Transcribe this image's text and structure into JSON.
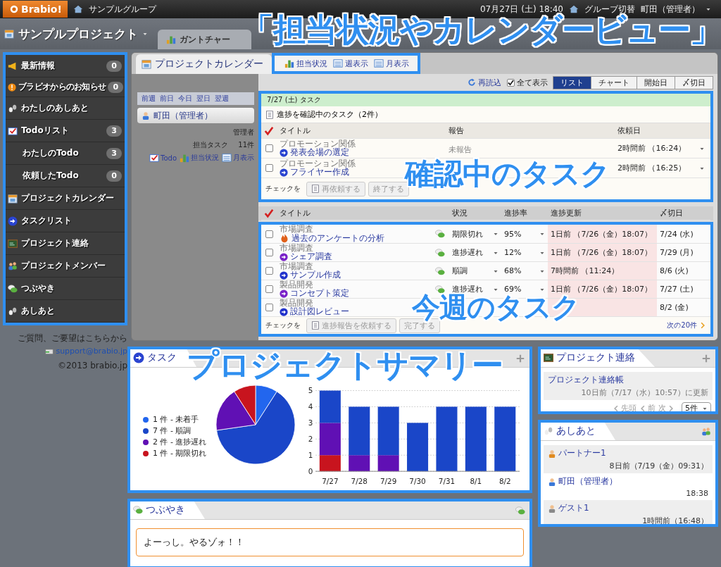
{
  "top_bar": {
    "logo": "Brabio!",
    "group": "サンプルグループ",
    "datetime": "07月27日 (土) 18:40",
    "switch": "グループ切替",
    "user": "町田（管理者）"
  },
  "project_bar": {
    "title": "サンプルプロジェクト",
    "tabs": [
      {
        "label": "ガントチャー",
        "selected": false
      }
    ]
  },
  "sidebar": {
    "items": [
      {
        "label": "最新情報",
        "count": "0",
        "kind": "main"
      },
      {
        "label": "ブラビオからのお知らせ",
        "count": "0",
        "kind": "notice"
      },
      {
        "label": "わたしのあしあと",
        "kind": "main"
      },
      {
        "label": "Todoリスト",
        "count": "3",
        "kind": "main"
      },
      {
        "label": "わたしのTodo",
        "count": "3",
        "kind": "sub"
      },
      {
        "label": "依頼したTodo",
        "count": "0",
        "kind": "sub"
      },
      {
        "label": "プロジェクトカレンダー",
        "kind": "main"
      },
      {
        "label": "タスクリスト",
        "kind": "main"
      },
      {
        "label": "プロジェクト連絡",
        "kind": "main"
      },
      {
        "label": "プロジェクトメンバー",
        "kind": "main"
      },
      {
        "label": "つぶやき",
        "kind": "main"
      },
      {
        "label": "あしあと",
        "kind": "main"
      }
    ],
    "footer": {
      "question": "ご質問、ご要望はこちらから",
      "email": "support@brabio.jp",
      "copyright": "©2013 brabio.jp"
    }
  },
  "calendar": {
    "title": "プロジェクトカレンダー",
    "views": [
      "担当状況",
      "週表示",
      "月表示"
    ],
    "nav": [
      "前週",
      "前日",
      "今日",
      "翌日",
      "翌週"
    ],
    "user": "町田（管理者）",
    "role": "管理者",
    "task_label": "担当タスク",
    "task_count": "11件",
    "links": [
      "Todo",
      "担当状況",
      "月表示"
    ],
    "toolbar": {
      "reload": "再読込",
      "show_all": {
        "label": "全て表示",
        "checked": true
      },
      "modes": [
        {
          "label": "リスト",
          "selected": true
        },
        {
          "label": "チャート",
          "selected": false
        },
        {
          "label": "開始日",
          "selected": false
        },
        {
          "label": "〆切日",
          "selected": false
        }
      ]
    },
    "confirm": {
      "date_header": "7/27 (土) タスク",
      "title": "進捗を確認中のタスク（2件）",
      "columns": [
        "タイトル",
        "報告",
        "依頼日"
      ],
      "rows": [
        {
          "category": "プロモーション関係",
          "title": "発表会場の選定",
          "report": "未報告",
          "requested": "2時間前 （16:24）",
          "checked": false
        },
        {
          "category": "プロモーション関係",
          "title": "フライヤー作成",
          "requested": "2時間前 （16:25）",
          "checked": false
        }
      ],
      "action_label": "チェックを",
      "buttons": [
        "再依頼する",
        "終了する"
      ]
    },
    "week": {
      "columns": [
        "タイトル",
        "状況",
        "進捗率",
        "進捗更新",
        "〆切日"
      ],
      "rows": [
        {
          "category": "市場調査",
          "title": "過去のアンケートの分析",
          "kind": "overdue",
          "color": "#e0601a",
          "status": "期限切れ",
          "progress": "95%",
          "updated": "1日前 （7/26（金）18:07）",
          "due": "7/24 (水)",
          "checked": false
        },
        {
          "category": "市場調査",
          "title": "シェア調査",
          "kind": "task",
          "color": "#7a22c8",
          "status": "進捗遅れ",
          "progress": "12%",
          "updated": "1日前 （7/26（金）18:07）",
          "due": "7/29 (月)",
          "checked": false
        },
        {
          "category": "市場調査",
          "title": "サンプル作成",
          "kind": "task",
          "color": "#2233cc",
          "status": "順調",
          "progress": "68%",
          "updated": "7時間前 （11:24）",
          "due": "8/6 (火)",
          "checked": false
        },
        {
          "category": "製品開発",
          "title": "コンセプト策定",
          "kind": "task",
          "color": "#7a22c8",
          "status": "進捗遅れ",
          "progress": "69%",
          "updated": "1日前 （7/26（金）18:07）",
          "due": "7/27 (土)",
          "checked": false
        },
        {
          "category": "製品開発",
          "title": "設計図レビュー",
          "kind": "task",
          "color": "#2233cc",
          "due": "8/2 (金)",
          "checked": false
        }
      ],
      "action_label": "チェックを",
      "buttons": [
        "進捗報告を依頼する",
        "完了する"
      ],
      "next": "次の20件"
    }
  },
  "summary": {
    "title": "タスク",
    "legend": [
      {
        "label": "1 件 - 未着手",
        "color": "#2266ee"
      },
      {
        "label": "7 件 - 順調",
        "color": "#1a46c8"
      },
      {
        "label": "2 件 - 進捗遅れ",
        "color": "#6010b4"
      },
      {
        "label": "1 件 - 期限切れ",
        "color": "#c8141e"
      }
    ],
    "pie": {
      "chart_data": {
        "type": "pie",
        "values": [
          9.09,
          63.64,
          18.18,
          9.09
        ]
      }
    },
    "bars": {
      "chart_data": {
        "type": "bar",
        "stacked": true,
        "categories": [
          "7/27",
          "7/28",
          "7/29",
          "7/30",
          "7/31",
          "8/1",
          "8/2"
        ],
        "series": [
          {
            "color": "#c8141e",
            "values": [
              1,
              0,
              0,
              0,
              0,
              0,
              0
            ]
          },
          {
            "color": "#6010b4",
            "values": [
              2,
              1,
              1,
              0,
              0,
              0,
              0
            ]
          },
          {
            "color": "#1a46c8",
            "values": [
              2,
              3,
              3,
              3,
              4,
              4,
              4
            ]
          }
        ],
        "ylim": [
          0,
          5
        ],
        "yticks": [
          0,
          1,
          2,
          3,
          4,
          5
        ],
        "grid": true
      }
    }
  },
  "tsubuyaki": {
    "title": "つぶやき",
    "message": "よーっし。やるゾォ！！"
  },
  "contact": {
    "title": "プロジェクト連絡",
    "item_title": "プロジェクト連絡帳",
    "item_updated": "10日前（7/17（水）10:57）に更新",
    "pager": [
      "先頭",
      "前",
      "次"
    ],
    "per_page": "5件"
  },
  "ashiato": {
    "title": "あしあと",
    "visits": [
      {
        "name": "パートナー1",
        "time": "8日前（7/19（金）09:31）",
        "color": "#e08a20"
      },
      {
        "name": "町田（管理者）",
        "time": "18:38",
        "color": "#3a78d8"
      },
      {
        "name": "ゲスト1",
        "time": "1時間前（16:48）",
        "color": "#8a8a8a"
      }
    ]
  },
  "captions": [
    "「担当状況やカレンダービュー」",
    "確認中のタスク",
    "今週のタスク",
    "プロジェクトサマリー"
  ]
}
